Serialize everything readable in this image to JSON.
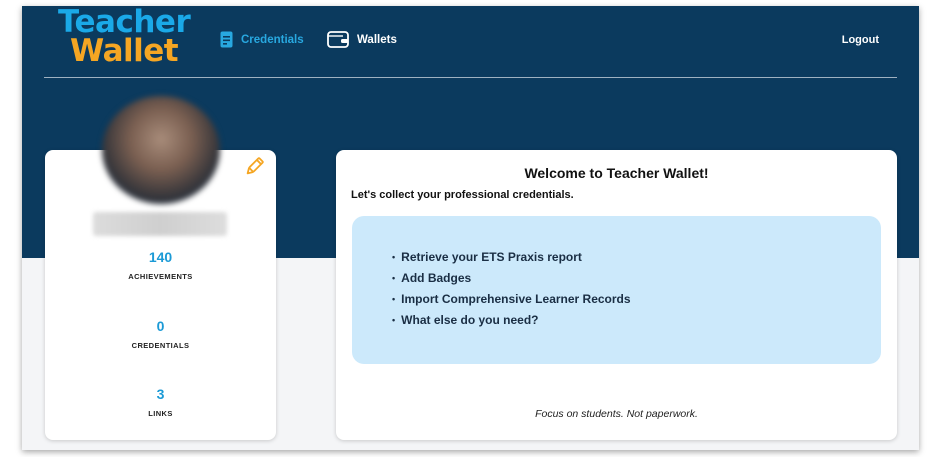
{
  "logo": {
    "line1": "Teacher",
    "line2": "Wallet"
  },
  "nav": {
    "credentials_label": "Credentials",
    "wallets_label": "Wallets",
    "logout_label": "Logout"
  },
  "profile": {
    "stats": [
      {
        "value": "140",
        "label": "ACHIEVEMENTS"
      },
      {
        "value": "0",
        "label": "CREDENTIALS"
      },
      {
        "value": "3",
        "label": "LINKS"
      }
    ]
  },
  "welcome": {
    "title": "Welcome to Teacher Wallet!",
    "subtitle": "Let's collect your professional credentials.",
    "items": [
      "Retrieve your ETS Praxis report",
      "Add Badges",
      "Import Comprehensive Learner Records",
      "What else do you need?"
    ],
    "tagline": "Focus on students. Not paperwork."
  },
  "colors": {
    "header_bg": "#0b3a5e",
    "logo_blue": "#1aa9e8",
    "logo_orange": "#f5a623",
    "stat_blue": "#1b9ad6",
    "todo_bg": "#cce9fb"
  },
  "icons": {
    "credentials": "credentials-icon",
    "wallets": "wallet-icon",
    "edit": "pencil-icon"
  }
}
